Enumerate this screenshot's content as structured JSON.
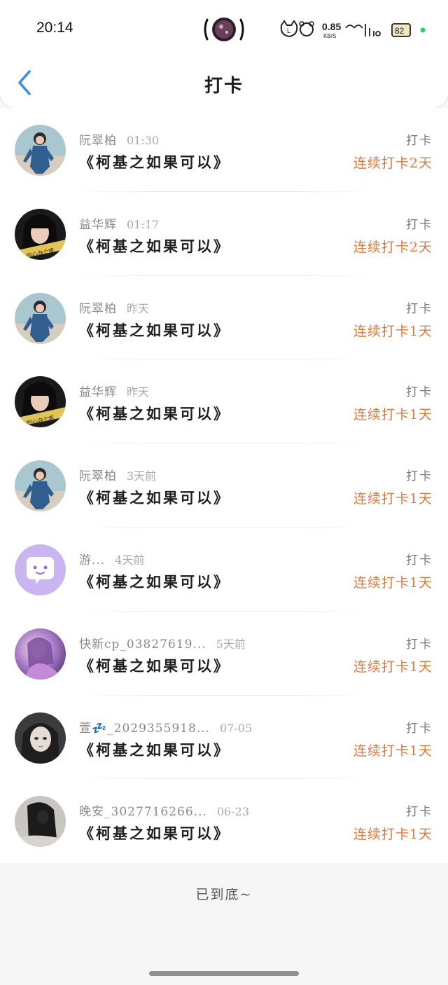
{
  "status_bar": {
    "time": "20:14",
    "net_speed_value": "0.85",
    "net_speed_unit": "KB/S",
    "battery": "82",
    "recording_dot_color": "#2ecc71"
  },
  "nav": {
    "title": "打卡",
    "back_icon": "chevron-left-icon"
  },
  "items": [
    {
      "name": "阮翠柏",
      "time": "01:30",
      "content": "《柯基之如果可以》",
      "action": "打卡",
      "streak": "连续打卡2天",
      "avatar": "boy"
    },
    {
      "name": "益华辉",
      "time": "01:17",
      "content": "《柯基之如果可以》",
      "action": "打卡",
      "streak": "连续打卡2天",
      "avatar": "girl"
    },
    {
      "name": "阮翠柏",
      "time": "昨天",
      "content": "《柯基之如果可以》",
      "action": "打卡",
      "streak": "连续打卡1天",
      "avatar": "boy"
    },
    {
      "name": "益华辉",
      "time": "昨天",
      "content": "《柯基之如果可以》",
      "action": "打卡",
      "streak": "连续打卡1天",
      "avatar": "girl"
    },
    {
      "name": "阮翠柏",
      "time": "3天前",
      "content": "《柯基之如果可以》",
      "action": "打卡",
      "streak": "连续打卡1天",
      "avatar": "boy"
    },
    {
      "name": "游...",
      "time": "4天前",
      "content": "《柯基之如果可以》",
      "action": "打卡",
      "streak": "连续打卡1天",
      "avatar": "chat"
    },
    {
      "name": "快新cp_03827619...",
      "time": "5天前",
      "content": "《柯基之如果可以》",
      "action": "打卡",
      "streak": "连续打卡1天",
      "avatar": "purple"
    },
    {
      "name": "萱💤_2029355918...",
      "time": "07-05",
      "content": "《柯基之如果可以》",
      "action": "打卡",
      "streak": "连续打卡1天",
      "avatar": "doll"
    },
    {
      "name": "晚安_3027716266...",
      "time": "06-23",
      "content": "《柯基之如果可以》",
      "action": "打卡",
      "streak": "连续打卡1天",
      "avatar": "longhair"
    }
  ],
  "avatar_text": "个的心自个疼",
  "footer": {
    "end_text": "已到底~"
  },
  "colors": {
    "accent_back": "#3a8ee6",
    "streak": "#e07a3c",
    "chat_avatar_bg": "#c9b5f0"
  }
}
